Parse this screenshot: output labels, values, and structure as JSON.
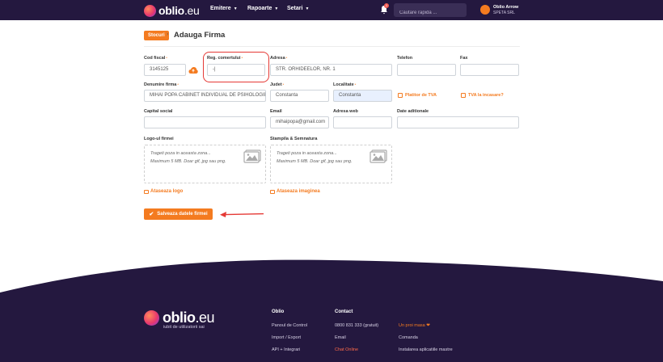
{
  "header": {
    "logo_name": "oblio",
    "logo_tld": ".eu",
    "nav": [
      {
        "label": "Emitere"
      },
      {
        "label": "Rapoarte"
      },
      {
        "label": "Setari"
      }
    ],
    "notification_count": "1",
    "search_placeholder": "Cautare rapida ...",
    "user_name": "Oblio Arrow",
    "user_company": "SPETA SRL"
  },
  "breadcrumb": {
    "badge": "Stocuri",
    "title": "Adauga Firma"
  },
  "form": {
    "cod_fiscal": {
      "label": "Cod fiscal",
      "value": "3145125"
    },
    "reg_comertului": {
      "label": "Reg. comertului",
      "value": "-|"
    },
    "adresa": {
      "label": "Adresa",
      "value": "STR. ORHIDEELOR, NR. 1"
    },
    "telefon": {
      "label": "Telefon",
      "value": ""
    },
    "fax": {
      "label": "Fax",
      "value": ""
    },
    "denumire": {
      "label": "Denumire firma",
      "value": "MIHAI POPA CABINET INDIVIDUAL DE PSIHOLOGIE"
    },
    "judet": {
      "label": "Judet",
      "value": "Constanta"
    },
    "localitate": {
      "label": "Localitate",
      "value": "Constanta"
    },
    "platitor_tva": {
      "label": "Platitor de TVA",
      "checked": false
    },
    "tva_incasare": {
      "label": "TVA la incasare?",
      "checked": false
    },
    "capital_social": {
      "label": "Capital social",
      "value": ""
    },
    "email": {
      "label": "Email",
      "value": "mihaipopa@gmail.com"
    },
    "adresa_web": {
      "label": "Adresa web",
      "value": ""
    },
    "date_aditionale": {
      "label": "Date aditionale",
      "value": ""
    },
    "logo": {
      "label": "Logo-ul firmei",
      "drop_line1": "Trageti poza in aceasta zona...",
      "drop_line2": "Maximum 5 MB. Doar gif, jpg sau png.",
      "attach_label": "Ataseaza logo"
    },
    "stampila": {
      "label": "Stampila & Semnatura",
      "drop_line1": "Trageti poza in aceasta zona...",
      "drop_line2": "Maximum 5 MB. Doar gif, jpg sau png.",
      "attach_label": "Ataseaza imaginea"
    },
    "save_label": "Salveaza datele firmei"
  },
  "footer": {
    "logo_name": "oblio",
    "logo_tld": ".eu",
    "tagline": "iubit de utilizatorii sai",
    "col_oblio": {
      "heading": "Oblio",
      "links": [
        "Panoul de Control",
        "Import / Export",
        "API + Integrari"
      ]
    },
    "col_contact": {
      "heading": "Contact",
      "links": [
        "0800 831 333 (gratuit)",
        "Email",
        "Chat Online"
      ]
    },
    "col_extra": {
      "links": [
        "Un proi masa ❤",
        "Comanda",
        "Instalarea aplicatiile mastre"
      ]
    }
  },
  "colors": {
    "brand_dark": "#24183f",
    "accent": "#f47b20",
    "highlight": "#e53935"
  }
}
